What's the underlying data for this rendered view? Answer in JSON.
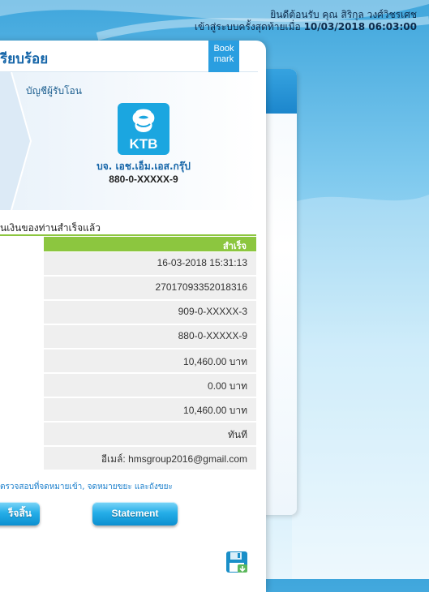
{
  "header": {
    "welcome_line": "ยินดีต้อนรับ คุณ สิริกุล วงศ์วิชรเศช",
    "last_login_prefix": "เข้าสู่ระบบครั้งสุดท้ายเมื่อ",
    "last_login_datetime": "10/03/2018 06:03:00"
  },
  "card": {
    "title": "รียบร้อย",
    "bookmark_line1": "Book",
    "bookmark_line2": "mark"
  },
  "recipient": {
    "label": "บัญชีผู้รับโอน",
    "bank_logo_text": "KTB",
    "bank_logo_icon": "ktb-logo-icon",
    "name": "บจ. เอช.เอ็ม.เอส.กรุ๊ป",
    "account": "880-0-XXXXX-9"
  },
  "transfer": {
    "success_message": "นเงินของท่านสำเร็จแล้ว",
    "status": "สำเร็จ",
    "details": [
      "16-03-2018 15:31:13",
      "27017093352018316",
      "909-0-XXXXX-3",
      "880-0-XXXXX-9",
      "10,460.00 บาท",
      "0.00 บาท",
      "10,460.00 บาท",
      "ทันที",
      "อีเมล์: hmsgroup2016@gmail.com"
    ]
  },
  "note": "ตรวจสอบที่จดหมายเข้า, จดหมายขยะ และถังขยะ",
  "buttons": {
    "finish": "ร็จสิ้น",
    "statement": "Statement"
  },
  "icons": {
    "save": "save-disk-icon",
    "bookmark": "bookmark-ribbon-icon"
  },
  "colors": {
    "accent_blue": "#1565a8",
    "success_green": "#8cc63f",
    "button_blue": "#26aee8",
    "row_bg": "#efefef"
  }
}
